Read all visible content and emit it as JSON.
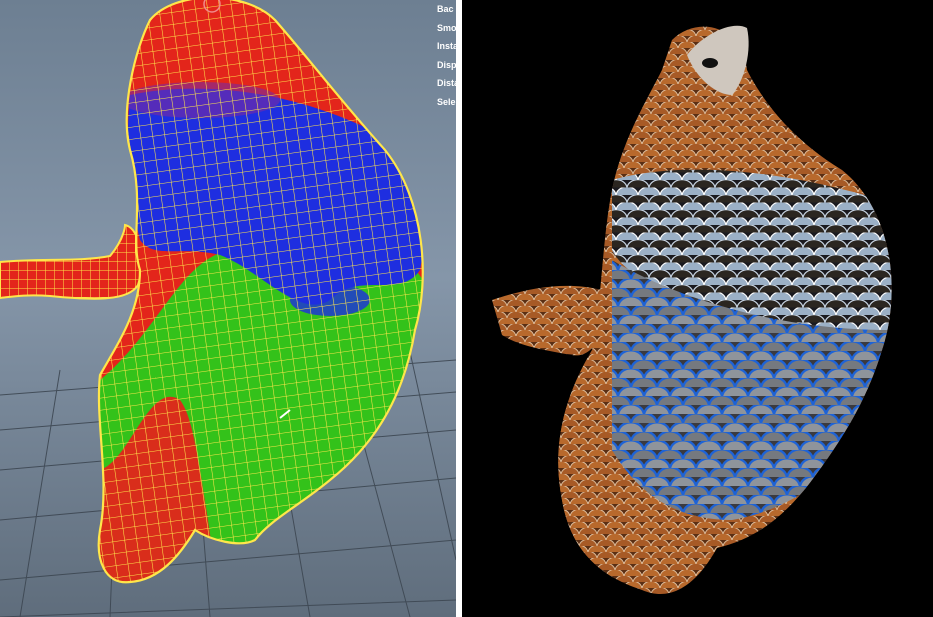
{
  "viewport": {
    "background_top": "#6d7f92",
    "background_bottom": "#5f6d7c",
    "wireframe_color": "#ffe64a",
    "heatmap_colors": {
      "high": "#e3251b",
      "mid": "#33c21a",
      "low": "#1e2ee0"
    },
    "hud_lines": [
      "Bac",
      "Smo",
      "Insta",
      "Disp",
      "Dista",
      "Sele"
    ]
  },
  "render": {
    "background": "#000000",
    "feather_colors": {
      "brown": "#a75a26",
      "grey_blue": "#9bb0c6",
      "blue_edge": "#1e63d6",
      "beak": "#cfc7be"
    }
  }
}
